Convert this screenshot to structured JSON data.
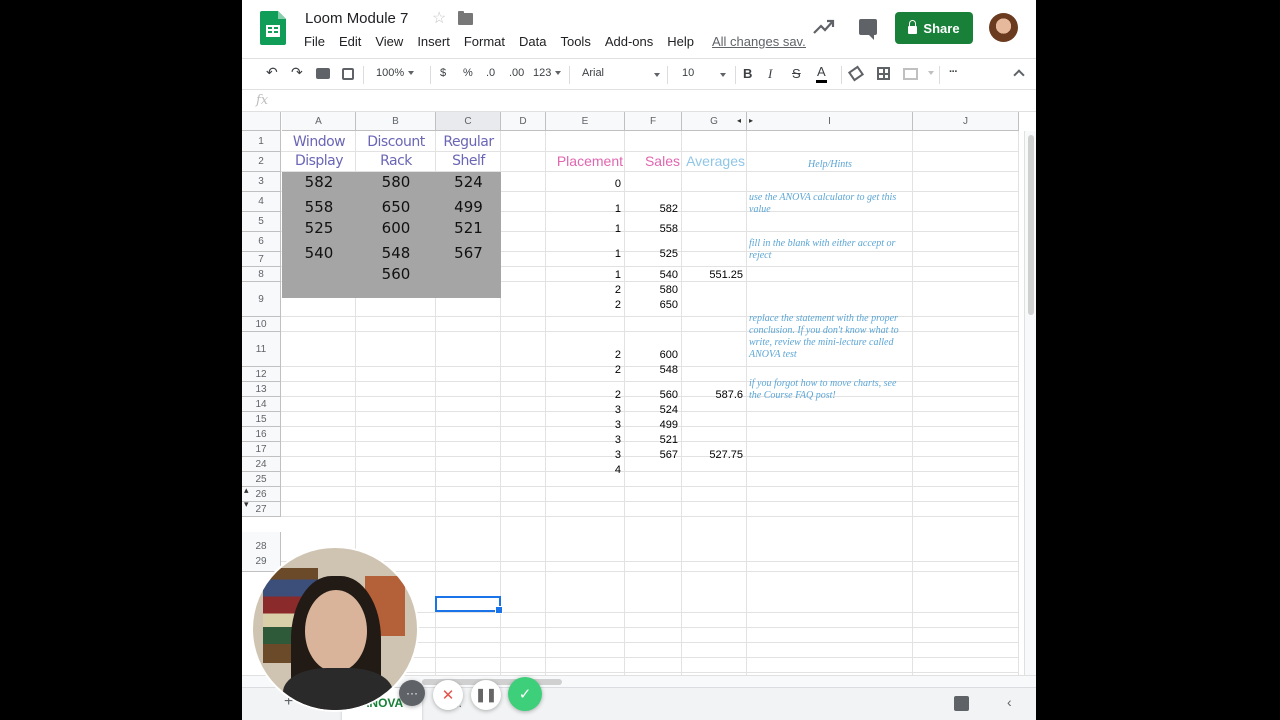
{
  "header": {
    "title": "Loom Module 7",
    "saved": "All changes sav...",
    "share_label": "Share",
    "menus": [
      "File",
      "Edit",
      "View",
      "Insert",
      "Format",
      "Data",
      "Tools",
      "Add-ons",
      "Help"
    ]
  },
  "toolbar": {
    "zoom": "100%",
    "currency": "$",
    "percent": "%",
    "dec_less": ".0",
    "dec_more": ".00",
    "format": "123",
    "font": "Arial",
    "font_size": "10",
    "bold": "B",
    "italic": "I",
    "strike": "S",
    "text_color": "A",
    "more": "···"
  },
  "formula": {
    "fx": "fx"
  },
  "columns": [
    "A",
    "B",
    "C",
    "D",
    "E",
    "F",
    "G",
    "I",
    "J"
  ],
  "rows": [
    "1",
    "2",
    "3",
    "4",
    "5",
    "6",
    "7",
    "8",
    "9",
    "10",
    "11",
    "12",
    "13",
    "14",
    "15",
    "16",
    "17",
    "24",
    "25",
    "26",
    "27",
    "28",
    "29"
  ],
  "headers": {
    "a": [
      "Window",
      "Display"
    ],
    "b": [
      "Discount",
      "Rack"
    ],
    "c": [
      "Regular",
      "Shelf"
    ],
    "placement": "Placement",
    "sales": "Sales",
    "averages": "Averages",
    "hints": "Help/Hints"
  },
  "groups": {
    "window": [
      "582",
      "558",
      "525",
      "540"
    ],
    "discount": [
      "580",
      "650",
      "600",
      "548",
      "560"
    ],
    "regular": [
      "524",
      "499",
      "521",
      "567"
    ]
  },
  "placement": [
    "0",
    "1",
    "1",
    "1",
    "1",
    "2",
    "2",
    "2",
    "2",
    "2",
    "3",
    "3",
    "3",
    "3",
    "4"
  ],
  "sales": [
    "582",
    "558",
    "525",
    "540",
    "580",
    "650",
    "600",
    "548",
    "560",
    "524",
    "499",
    "521",
    "567"
  ],
  "averages": [
    "551.25",
    "587.6",
    "527.75"
  ],
  "hints": [
    "use the ANOVA calculator to get this value",
    "fill in the blank with either accept or reject",
    "replace the statement with the proper conclusion. If you don't know what to write, review the mini-lecture called ANOVA test",
    "if you forgot how to move charts, see the Course FAQ post!"
  ],
  "sheets": {
    "active": "ANOVA",
    "other": "..."
  },
  "colors": {
    "share": "#188038",
    "placement": "#e066b0",
    "averages": "#8fc6e8",
    "hint": "#5aa5d6",
    "selection": "#1a73e8"
  }
}
